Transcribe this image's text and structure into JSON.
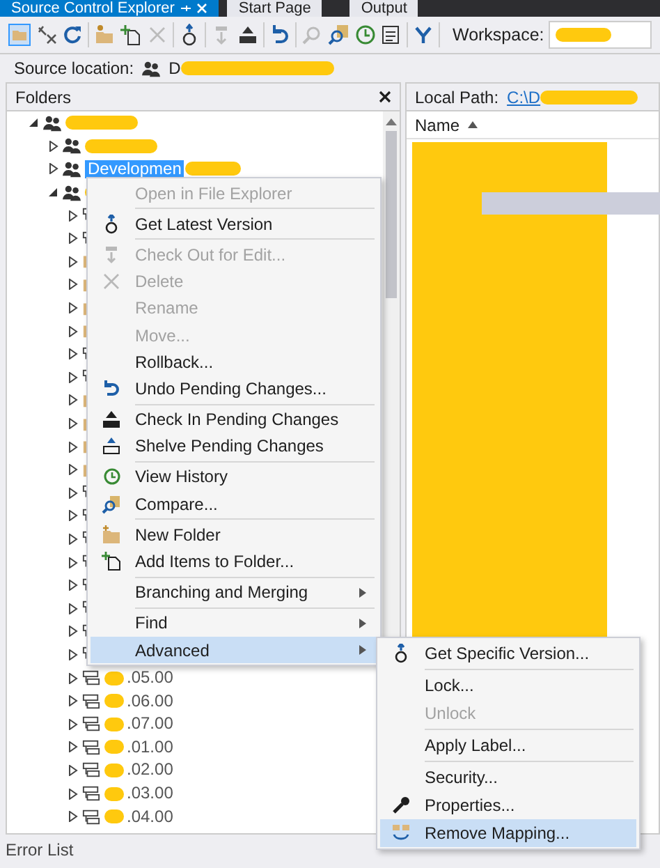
{
  "tabs": [
    {
      "label": "Source Control Explorer",
      "selected": true
    },
    {
      "label": "Start Page",
      "selected": false
    },
    {
      "label": "Output",
      "selected": false
    }
  ],
  "toolbar": {
    "workspace_label": "Workspace:"
  },
  "source_location": {
    "label": "Source location:",
    "value": "D"
  },
  "folders": {
    "title": "Folders",
    "tree": [
      {
        "kind": "team",
        "expanded": true,
        "selected": false,
        "children": [
          {
            "kind": "team",
            "expanded": false,
            "selected": false
          },
          {
            "kind": "team",
            "expanded": false,
            "label": "Developmen",
            "selected": true
          },
          {
            "kind": "team",
            "expanded": true,
            "selected": false,
            "children": [
              {
                "kind": "branch",
                "expanded": false,
                "selected": false
              },
              {
                "kind": "branch",
                "expanded": false,
                "selected": false
              },
              {
                "kind": "folder",
                "expanded": false,
                "selected": false
              },
              {
                "kind": "folder",
                "expanded": false,
                "selected": false
              },
              {
                "kind": "folder",
                "expanded": false,
                "selected": false
              },
              {
                "kind": "folder",
                "expanded": false,
                "selected": false
              },
              {
                "kind": "branch",
                "expanded": false,
                "selected": false
              },
              {
                "kind": "branch",
                "expanded": false,
                "selected": false
              },
              {
                "kind": "folder",
                "expanded": false,
                "selected": false
              },
              {
                "kind": "folder",
                "expanded": false,
                "selected": false
              },
              {
                "kind": "folder",
                "expanded": false,
                "selected": false
              },
              {
                "kind": "folder",
                "expanded": false,
                "selected": false
              },
              {
                "kind": "branch",
                "expanded": false,
                "selected": false
              },
              {
                "kind": "branch",
                "expanded": false,
                "selected": false
              },
              {
                "kind": "branch",
                "expanded": false,
                "selected": false
              },
              {
                "kind": "branch",
                "expanded": false,
                "selected": false
              },
              {
                "kind": "branch",
                "expanded": false,
                "selected": false
              },
              {
                "kind": "branch",
                "expanded": false,
                "selected": false
              },
              {
                "kind": "branch",
                "expanded": false,
                "selected": false
              },
              {
                "kind": "branch",
                "expanded": false,
                "selected": false
              },
              {
                "kind": "branch",
                "expanded": false,
                "label": ".05.00",
                "selected": false
              },
              {
                "kind": "branch",
                "expanded": false,
                "label": ".06.00",
                "selected": false
              },
              {
                "kind": "branch",
                "expanded": false,
                "label": ".07.00",
                "selected": false
              },
              {
                "kind": "branch",
                "expanded": false,
                "label": ".01.00",
                "selected": false
              },
              {
                "kind": "branch",
                "expanded": false,
                "label": ".02.00",
                "selected": false
              },
              {
                "kind": "branch",
                "expanded": false,
                "label": ".03.00",
                "selected": false
              },
              {
                "kind": "branch",
                "expanded": false,
                "label": ".04.00",
                "selected": false
              }
            ]
          }
        ]
      }
    ]
  },
  "local_path": {
    "label": "Local Path:",
    "value": "C:\\D"
  },
  "files": {
    "column": "Name"
  },
  "context_menu": [
    {
      "label": "Open in File Explorer",
      "disabled": true,
      "selected": false
    },
    {
      "label": "Get Latest Version",
      "disabled": false,
      "selected": false,
      "separator_before": true
    },
    {
      "label": "Check Out for Edit...",
      "disabled": true,
      "selected": false,
      "separator_before": true
    },
    {
      "label": "Delete",
      "disabled": true,
      "selected": false
    },
    {
      "label": "Rename",
      "disabled": true,
      "selected": false
    },
    {
      "label": "Move...",
      "disabled": true,
      "selected": false
    },
    {
      "label": "Rollback...",
      "disabled": false,
      "selected": false
    },
    {
      "label": "Undo Pending Changes...",
      "disabled": false,
      "selected": false
    },
    {
      "label": "Check In Pending Changes",
      "disabled": false,
      "selected": false,
      "separator_before": true
    },
    {
      "label": "Shelve Pending Changes",
      "disabled": false,
      "selected": false
    },
    {
      "label": "View History",
      "disabled": false,
      "selected": false,
      "separator_before": true
    },
    {
      "label": "Compare...",
      "disabled": false,
      "selected": false
    },
    {
      "label": "New Folder",
      "disabled": false,
      "selected": false,
      "separator_before": true
    },
    {
      "label": "Add Items to Folder...",
      "disabled": false,
      "selected": false
    },
    {
      "label": "Branching and Merging",
      "submenu": true,
      "disabled": false,
      "selected": false,
      "separator_before": true
    },
    {
      "label": "Find",
      "submenu": true,
      "disabled": false,
      "selected": false,
      "separator_before": true
    },
    {
      "label": "Advanced",
      "submenu": true,
      "disabled": false,
      "selected": true
    }
  ],
  "submenu": [
    {
      "label": "Get Specific Version...",
      "disabled": false,
      "selected": false
    },
    {
      "label": "Lock...",
      "disabled": false,
      "selected": false,
      "separator_before": true
    },
    {
      "label": "Unlock",
      "disabled": true,
      "selected": false
    },
    {
      "label": "Apply Label...",
      "disabled": false,
      "selected": false,
      "separator_before": true
    },
    {
      "label": "Security...",
      "disabled": false,
      "selected": false,
      "separator_before": true
    },
    {
      "label": "Properties...",
      "disabled": false,
      "selected": false
    },
    {
      "label": "Remove Mapping...",
      "disabled": false,
      "selected": true
    }
  ],
  "bottom_tab": "Error List"
}
